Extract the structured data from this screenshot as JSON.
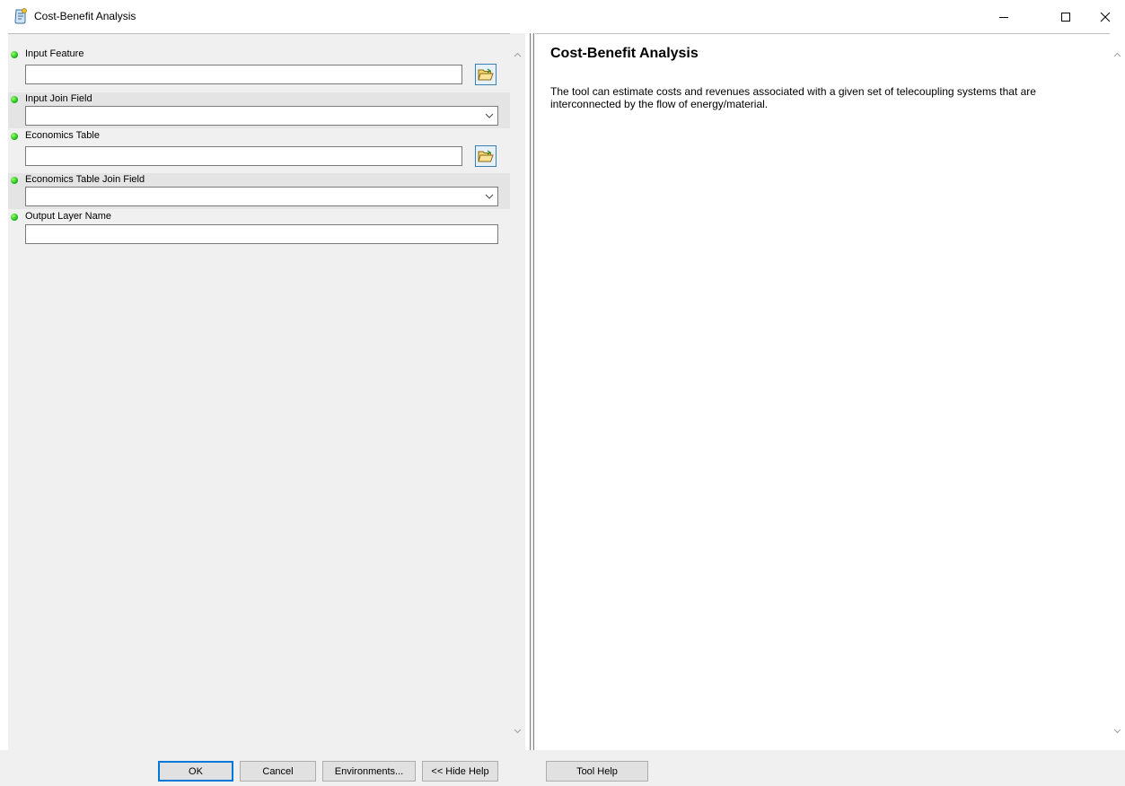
{
  "window": {
    "title": "Cost-Benefit Analysis",
    "icon": "script-tool-icon",
    "controls": [
      "minimize-icon",
      "maximize-icon",
      "close-icon"
    ]
  },
  "parameters": [
    {
      "label": "Input Feature",
      "type": "text-browse",
      "value": "",
      "required": true
    },
    {
      "label": "Input Join Field",
      "type": "combo",
      "value": "",
      "required": true
    },
    {
      "label": "Economics Table",
      "type": "text-browse",
      "value": "",
      "required": true
    },
    {
      "label": "Economics Table Join Field",
      "type": "combo",
      "value": "",
      "required": true
    },
    {
      "label": "Output Layer Name",
      "type": "text",
      "value": "",
      "required": true
    }
  ],
  "help": {
    "title": "Cost-Benefit Analysis",
    "description": "The tool can estimate costs and revenues associated with a given set of telecoupling systems that are interconnected by the flow of energy/material."
  },
  "buttons": {
    "ok": "OK",
    "cancel": "Cancel",
    "environments": "Environments...",
    "hide_help": "<< Hide Help",
    "tool_help": "Tool Help"
  },
  "colors": {
    "required_dot": "#1fbf1a",
    "default_button_border": "#0078d7",
    "panel_bg": "#f0f0f0"
  }
}
